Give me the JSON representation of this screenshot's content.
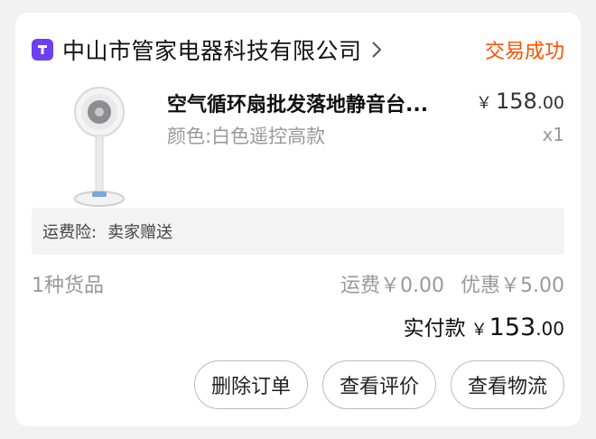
{
  "shop": {
    "name": "中山市管家电器科技有限公司",
    "status": "交易成功",
    "icon": "shop-logo-icon"
  },
  "product": {
    "title": "空气循环扇批发落地静音台...",
    "spec": "颜色:白色遥控高款",
    "price_symbol": "￥",
    "price_int": "158",
    "price_dec": ".00",
    "quantity": "x1",
    "image": "circulation-fan-image"
  },
  "insurance": {
    "label": "运费险:",
    "value": "卖家赠送"
  },
  "summary": {
    "count": "1种货品",
    "shipping": "运费￥0.00",
    "discount": "优惠￥5.00",
    "paid_label": "实付款",
    "paid_symbol": "￥",
    "paid_int": "153",
    "paid_dec": ".00"
  },
  "actions": {
    "delete": "删除订单",
    "review": "查看评价",
    "logistics": "查看物流"
  },
  "colors": {
    "status": "#ff5000",
    "shop_icon_bg": "#6c3ff0"
  }
}
